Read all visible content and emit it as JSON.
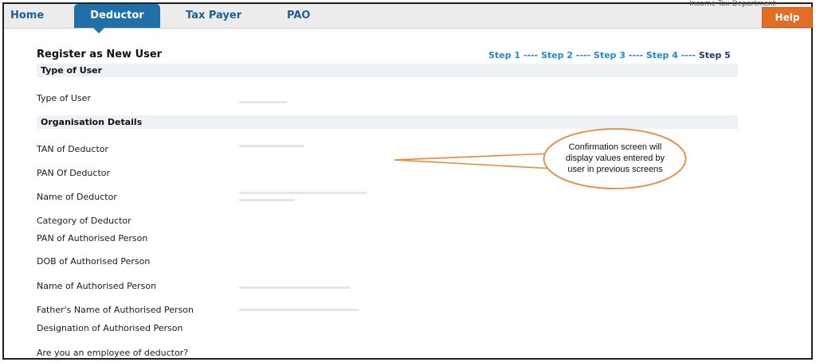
{
  "header": {
    "tabs": [
      {
        "label": "Home"
      },
      {
        "label": "Deductor",
        "active": true
      },
      {
        "label": "Tax Payer"
      },
      {
        "label": "PAO"
      }
    ],
    "help_label": "Help",
    "caption": "Income Tax Department"
  },
  "page": {
    "title": "Register as New User",
    "steps": [
      "Step 1",
      "Step 2",
      "Step 3",
      "Step 4",
      "Step 5"
    ],
    "current_step": "Step 5",
    "step_separator": "----"
  },
  "sections": {
    "type_of_user": "Type of User",
    "organisation_details": "Organisation Details"
  },
  "fields": {
    "type_of_user": "Type of User",
    "tan": "TAN of Deductor",
    "pan": "PAN Of Deductor",
    "name": "Name of Deductor",
    "category": "Category of Deductor",
    "pan_auth": "PAN of Authorised Person",
    "dob_auth": "DOB of Authorised Person",
    "name_auth": "Name of Authorised Person",
    "father_auth": "Father's Name of Authorised Person",
    "designation_auth": "Designation of Authorised Person",
    "employee": "Are you an employee of deductor?"
  },
  "callout": {
    "text": "Confirmation screen will display values entered by user in previous screens"
  },
  "colors": {
    "tab_active": "#1f6fa8",
    "tab_text": "#1d5e99",
    "help_button": "#e36d24",
    "step_link": "#1d8ad0",
    "callout_border": "#e8893a"
  }
}
